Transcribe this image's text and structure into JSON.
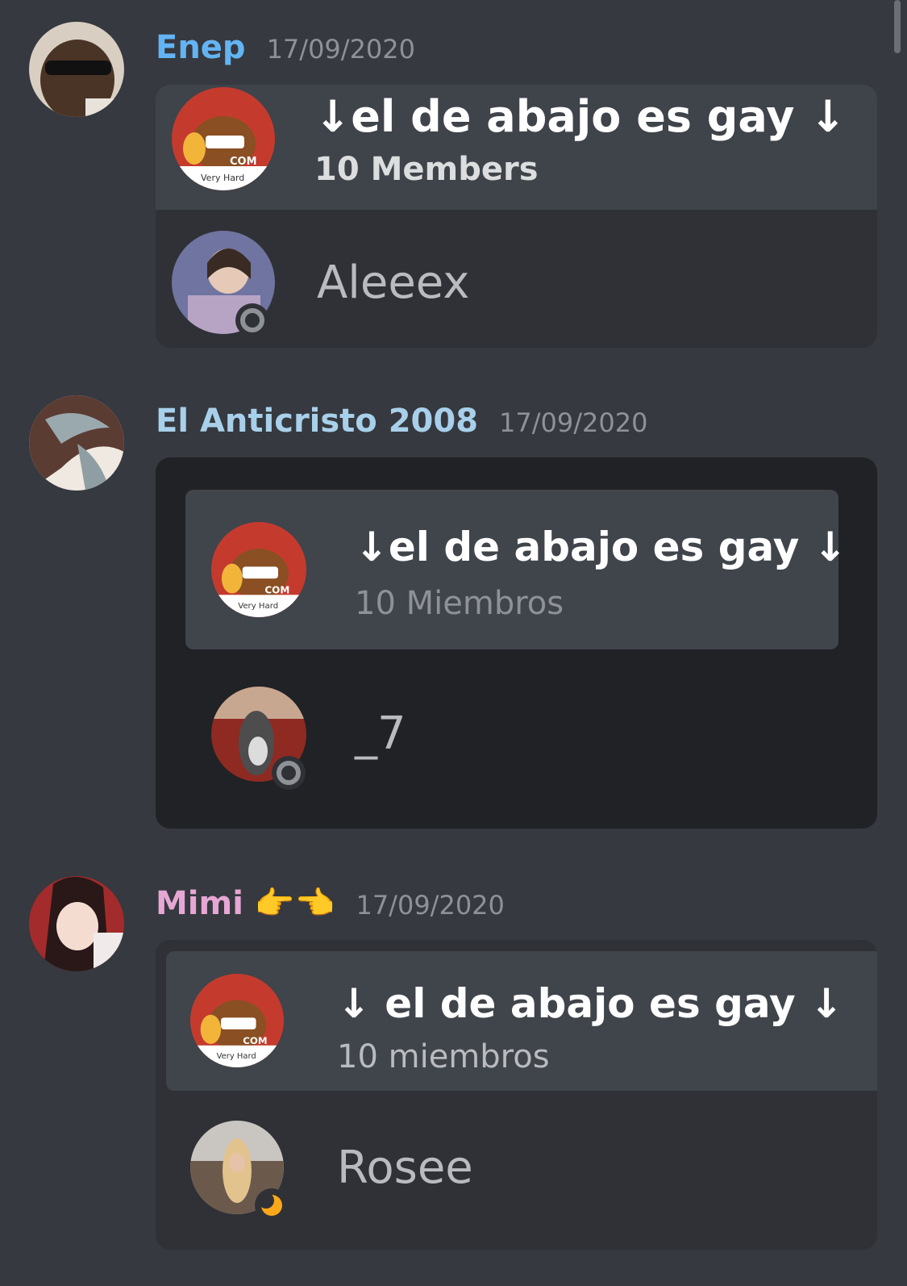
{
  "messages": [
    {
      "author": "Enep",
      "author_color": "#63b4f3",
      "timestamp": "17/09/2020",
      "server_name": "↓el de abajo es gay ↓",
      "members": "10 Members",
      "user": "Aleeex",
      "user_status": "offline"
    },
    {
      "author": "El Anticristo 2008",
      "author_color": "#a8d0ea",
      "timestamp": "17/09/2020",
      "server_name": "↓el de abajo es gay ↓",
      "members": "10 Miembros",
      "user": "_7",
      "user_status": "offline"
    },
    {
      "author": "Mimi 👉👈",
      "author_color": "#e6a7d4",
      "timestamp": "17/09/2020",
      "server_name": "↓ el de abajo es gay ↓",
      "members": "10 miembros",
      "user": "Rosee",
      "user_status": "idle"
    }
  ],
  "server_icon_text": {
    "badge": "COM",
    "caption": "Very Hard"
  },
  "colors": {
    "background": "#36393f",
    "card_dark": "#202225",
    "card_mid": "#2f3136",
    "server_row": "#40444b"
  }
}
